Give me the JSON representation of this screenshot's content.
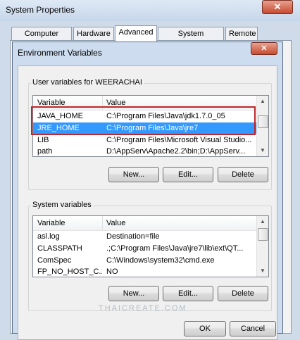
{
  "system_properties": {
    "title": "System Properties",
    "close_glyph": "✕",
    "tabs": [
      "Computer Name",
      "Hardware",
      "Advanced",
      "System Protection",
      "Remote"
    ],
    "active_tab": "Advanced",
    "ok_label": "OK",
    "cancel_label": "Cancel"
  },
  "env_dialog": {
    "title": "Environment Variables",
    "close_glyph": "✕",
    "user_section": {
      "label": "User variables for WEERACHAI",
      "columns": [
        "Variable",
        "Value"
      ],
      "rows": [
        {
          "variable": "JAVA_HOME",
          "value": "C:\\Program Files\\Java\\jdk1.7.0_05"
        },
        {
          "variable": "JRE_HOME",
          "value": "C:\\Program Files\\Java\\jre7"
        },
        {
          "variable": "LIB",
          "value": "C:\\Program Files\\Microsoft Visual Studio..."
        },
        {
          "variable": "path",
          "value": "D:\\AppServ\\Apache2.2\\bin;D:\\AppServ..."
        }
      ],
      "selected_row": 1,
      "buttons": {
        "new": "New...",
        "edit": "Edit...",
        "delete": "Delete"
      }
    },
    "system_section": {
      "label": "System variables",
      "columns": [
        "Variable",
        "Value"
      ],
      "rows": [
        {
          "variable": "asl.log",
          "value": "Destination=file"
        },
        {
          "variable": "CLASSPATH",
          "value": ".;C:\\Program Files\\Java\\jre7\\lib\\ext\\QT..."
        },
        {
          "variable": "ComSpec",
          "value": "C:\\Windows\\system32\\cmd.exe"
        },
        {
          "variable": "FP_NO_HOST_C...",
          "value": "NO"
        }
      ],
      "buttons": {
        "new": "New...",
        "edit": "Edit...",
        "delete": "Delete"
      }
    }
  },
  "watermark": "THAICREATE.COM",
  "icons": {
    "scroll_up": "▲",
    "scroll_down": "▼"
  },
  "colors": {
    "selection": "#3399ff",
    "highlight_box": "#c0262b",
    "close_button": "#c74a30"
  }
}
